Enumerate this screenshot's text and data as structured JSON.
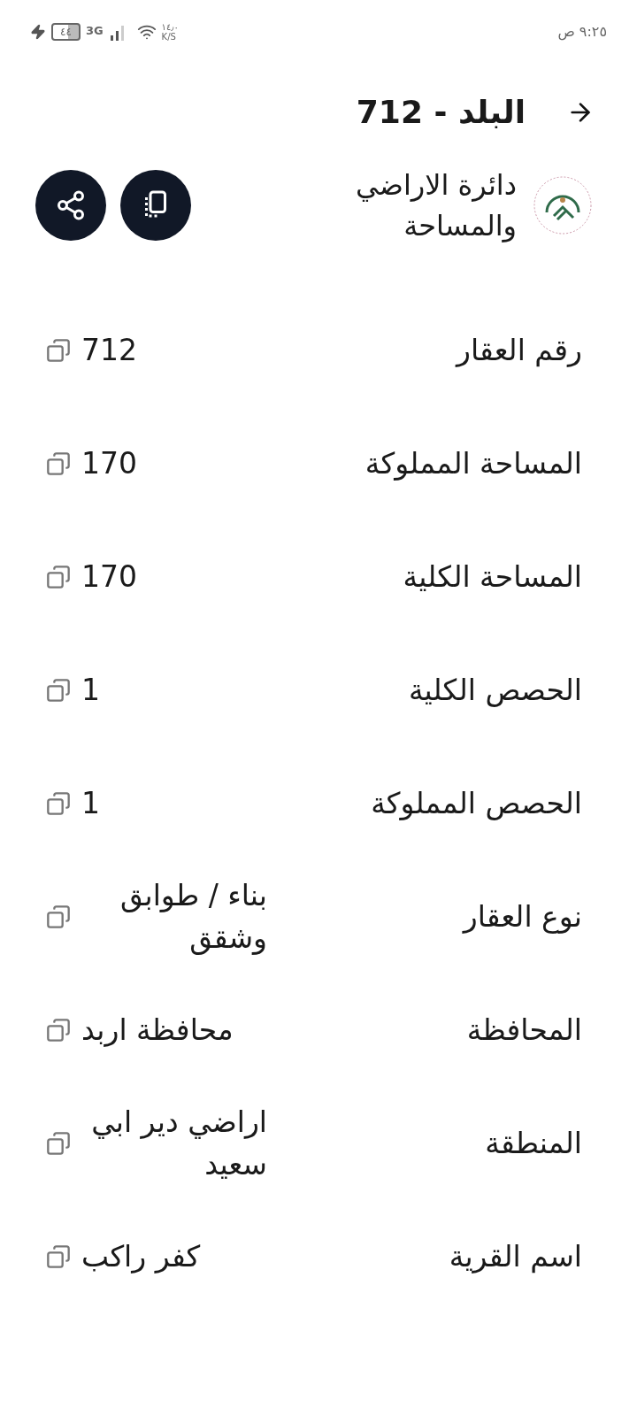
{
  "status_bar": {
    "time": "٩:٢٥ ص",
    "battery": "٤٤",
    "network": "3G",
    "speed": "١٤٫٠",
    "speed_unit": "K/S"
  },
  "header": {
    "title": "البلد - 712"
  },
  "organization": {
    "name": "دائرة الاراضي والمساحة"
  },
  "fields": [
    {
      "label": "رقم العقار",
      "value": "712"
    },
    {
      "label": "المساحة المملوكة",
      "value": "170"
    },
    {
      "label": "المساحة الكلية",
      "value": "170"
    },
    {
      "label": "الحصص الكلية",
      "value": "1"
    },
    {
      "label": "الحصص المملوكة",
      "value": "1"
    },
    {
      "label": "نوع العقار",
      "value": "بناء / طوابق وشقق"
    },
    {
      "label": "المحافظة",
      "value": "محافظة اربد"
    },
    {
      "label": "المنطقة",
      "value": "اراضي دير ابي سعيد"
    },
    {
      "label": "اسم القرية",
      "value": "كفر راكب"
    }
  ]
}
